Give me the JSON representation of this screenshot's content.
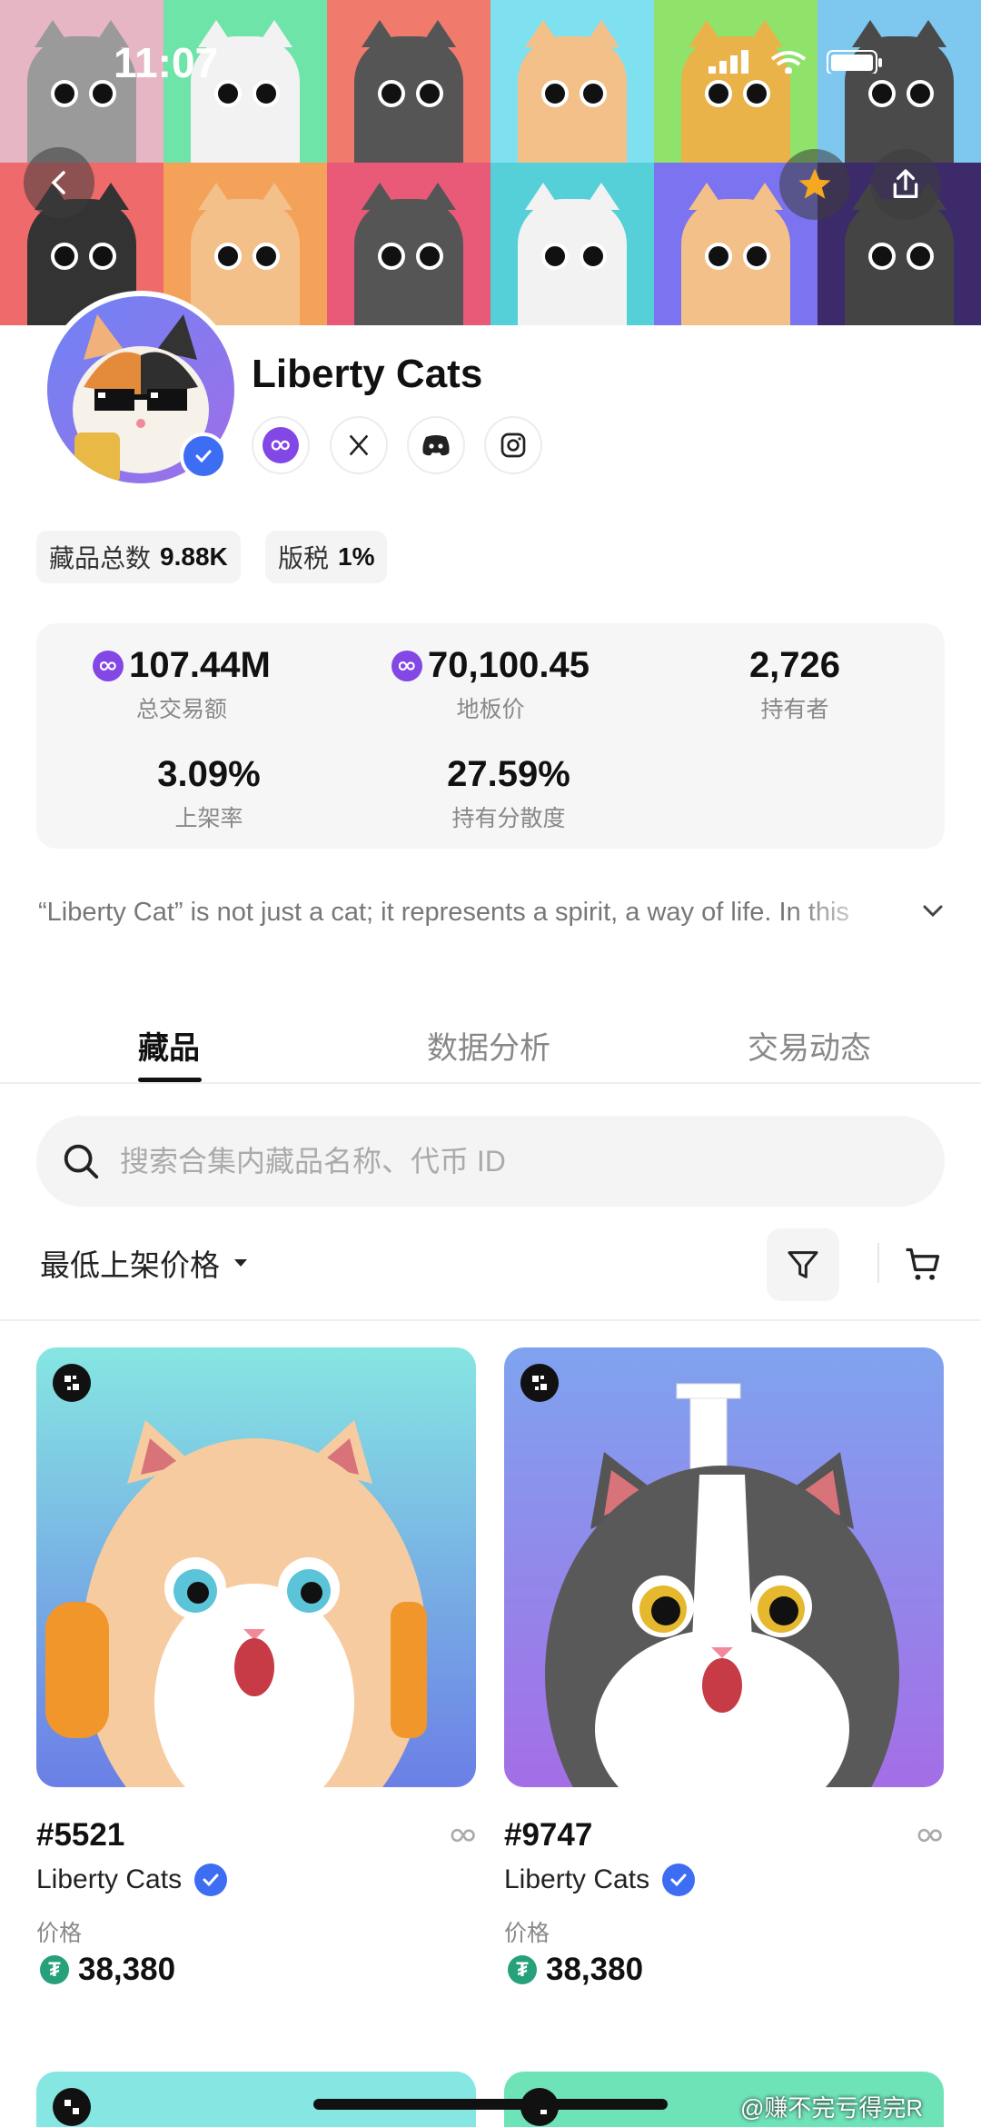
{
  "status_bar": {
    "time": "11:07"
  },
  "collection": {
    "name": "Liberty Cats",
    "social_links": [
      "polygon-icon",
      "x-icon",
      "discord-icon",
      "instagram-icon"
    ],
    "total_items_label": "藏品总数",
    "total_items_value": "9.88K",
    "royalty_label": "版税",
    "royalty_value": "1%",
    "description": "“Liberty Cat” is not just a cat; it represents a spirit, a way of life. In this"
  },
  "stats": {
    "volume": {
      "value": "107.44M",
      "label": "总交易额"
    },
    "floor": {
      "value": "70,100.45",
      "label": "地板价"
    },
    "holders": {
      "value": "2,726",
      "label": "持有者"
    },
    "listed": {
      "value": "3.09%",
      "label": "上架率"
    },
    "distribution": {
      "value": "27.59%",
      "label": "持有分散度"
    }
  },
  "tabs": [
    "藏品",
    "数据分析",
    "交易动态"
  ],
  "search": {
    "placeholder": "搜索合集内藏品名称、代币 ID"
  },
  "toolbar": {
    "sort_label": "最低上架价格"
  },
  "items": [
    {
      "id": "#5521",
      "collection": "Liberty Cats",
      "price_label": "价格",
      "price": "38,380"
    },
    {
      "id": "#9747",
      "collection": "Liberty Cats",
      "price_label": "价格",
      "price": "38,380"
    }
  ],
  "watermark": "@赚不完亏得完R",
  "colors": {
    "accent_purple": "#8247e5",
    "verified_blue": "#3d6df2",
    "usdt_green": "#26a17b"
  }
}
